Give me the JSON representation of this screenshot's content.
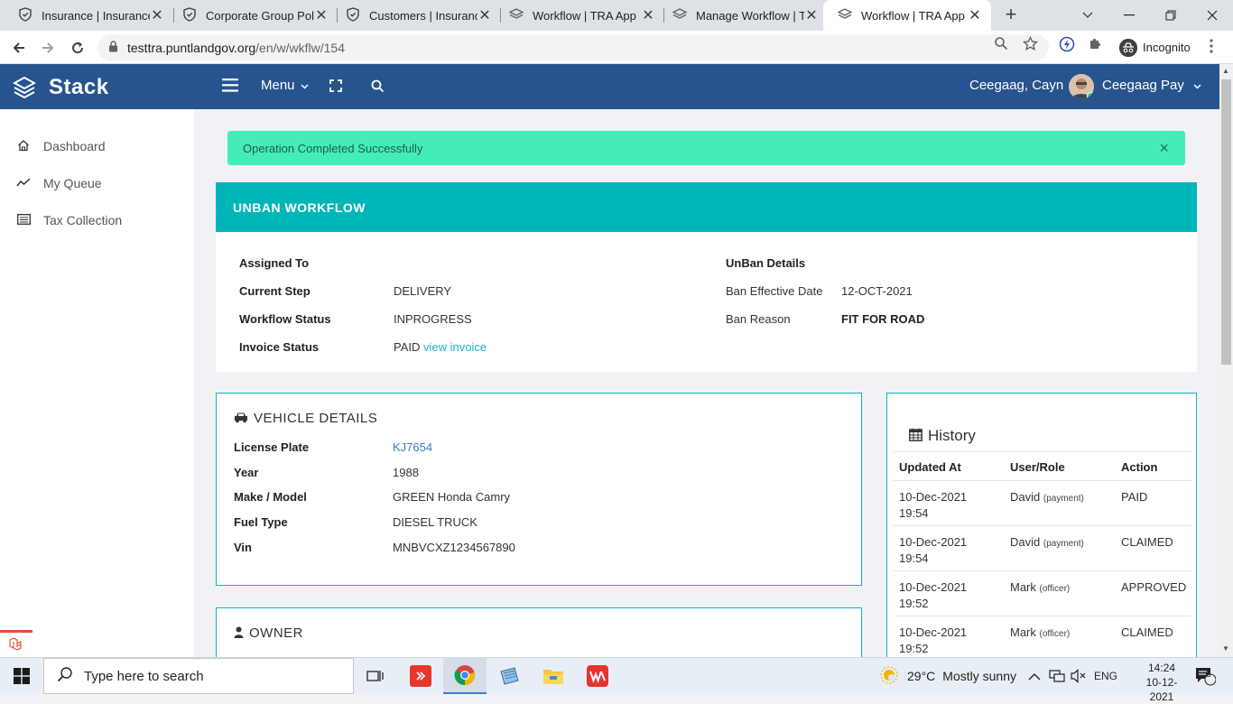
{
  "browser": {
    "tabs": [
      {
        "title": "Insurance | Insurance",
        "icon": "shield-icon",
        "active": false
      },
      {
        "title": "Corporate Group Polic",
        "icon": "shield-icon",
        "active": false
      },
      {
        "title": "Customers | Insurance",
        "icon": "shield-icon",
        "active": false
      },
      {
        "title": "Workflow | TRA App",
        "icon": "stack-icon",
        "active": false
      },
      {
        "title": "Manage Workflow | TI",
        "icon": "stack-icon",
        "active": false
      },
      {
        "title": "Workflow | TRA App",
        "icon": "stack-icon",
        "active": true
      }
    ],
    "close_glyph": "✕",
    "new_tab": "+",
    "url_host": "testtra.puntlandgov.org",
    "url_path": "/en/w/wkflw/154",
    "incognito_label": "Incognito"
  },
  "header": {
    "brand": "Stack",
    "menu_label": "Menu",
    "user_name": "Ceegaag, Cayn",
    "account_name": "Ceegaag Pay"
  },
  "sidebar": {
    "items": [
      {
        "label": "Dashboard",
        "icon": "home-icon"
      },
      {
        "label": "My Queue",
        "icon": "trend-line-icon"
      },
      {
        "label": "Tax Collection",
        "icon": "list-icon"
      }
    ]
  },
  "alert": {
    "message": "Operation Completed Successfully",
    "close": "×",
    "color": "#45ecb8"
  },
  "workflow": {
    "title": "UNBAN WORKFLOW",
    "header_color": "#00b5b8",
    "assigned_to_label": "Assigned To",
    "current_step_label": "Current Step",
    "current_step": "DELIVERY",
    "workflow_status_label": "Workflow Status",
    "workflow_status": "INPROGRESS",
    "invoice_status_label": "Invoice Status",
    "invoice_status": "PAID",
    "view_invoice": "view invoice",
    "unban_details_label": "UnBan Details",
    "ban_effective_date_label": "Ban Effective Date",
    "ban_effective_date": "12-OCT-2021",
    "ban_reason_label": "Ban Reason",
    "ban_reason": "FIT FOR ROAD"
  },
  "vehicle": {
    "title": "VEHICLE DETAILS",
    "rows": [
      {
        "label": "License Plate",
        "value": "KJ7654"
      },
      {
        "label": "Year",
        "value": "1988"
      },
      {
        "label": "Make / Model",
        "value": "GREEN Honda Camry"
      },
      {
        "label": "Fuel Type",
        "value": "DIESEL TRUCK"
      },
      {
        "label": "Vin",
        "value": "MNBVCXZ1234567890"
      }
    ]
  },
  "owner": {
    "title": "OWNER"
  },
  "history": {
    "title": "History",
    "columns": [
      "Updated At",
      "User/Role",
      "Action"
    ],
    "rows": [
      {
        "date": "10-Dec-2021",
        "time": "19:54",
        "user": "David",
        "role": "(payment)",
        "action": "PAID"
      },
      {
        "date": "10-Dec-2021",
        "time": "19:54",
        "user": "David",
        "role": "(payment)",
        "action": "CLAIMED"
      },
      {
        "date": "10-Dec-2021",
        "time": "19:52",
        "user": "Mark",
        "role": "(officer)",
        "action": "APPROVED"
      },
      {
        "date": "10-Dec-2021",
        "time": "19:52",
        "user": "Mark",
        "role": "(officer)",
        "action": "CLAIMED"
      }
    ]
  },
  "taskbar": {
    "search_placeholder": "Type here to search",
    "weather_temp": "29°C",
    "weather_text": "Mostly sunny",
    "language": "ENG",
    "time": "14:24",
    "date": "10-12-2021",
    "notification_count": "3"
  }
}
